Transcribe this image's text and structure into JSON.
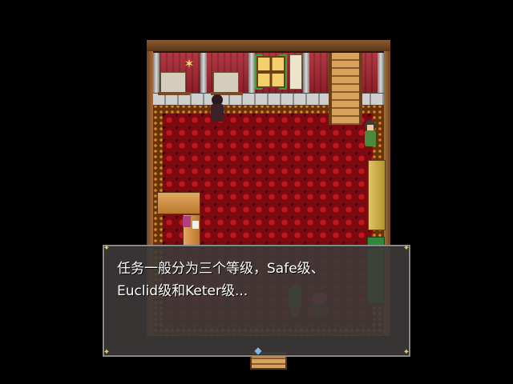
{
  "dialogue": {
    "lines": [
      "任务一般分为三个等级，Safe级、",
      "Euclid级和Keter级..."
    ],
    "continue_indicator": "◆",
    "corner_glyph": "✦"
  },
  "map": {
    "chandelier_glyph": "✶"
  },
  "colors": {
    "carpet": "#7c0a10",
    "wall": "#b23a44",
    "message_bg": "#3e3a3a",
    "message_text": "#ffffff"
  }
}
